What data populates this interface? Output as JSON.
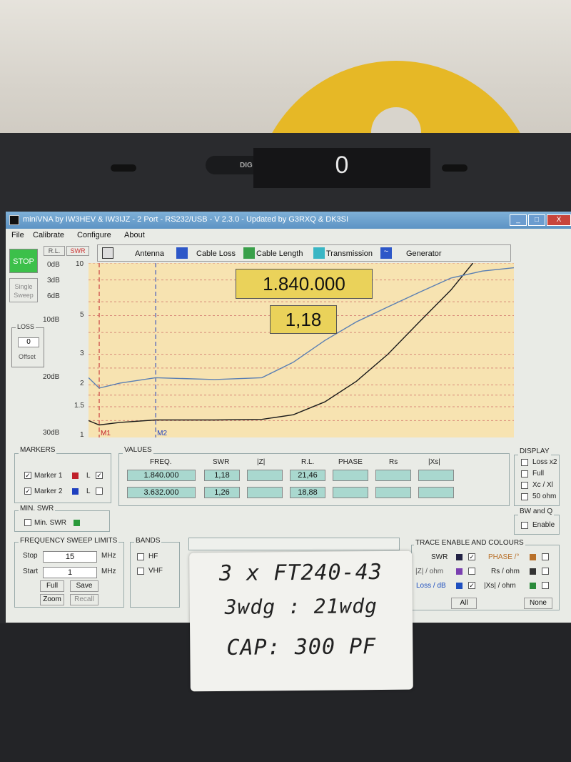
{
  "environment": {
    "digital_display": {
      "label": "DIG",
      "value": "0"
    }
  },
  "window": {
    "title": "miniVNA by IW3HEV & IW3IJZ - 2 Port - RS232/USB - V 2.3.0 - Updated by G3RXQ & DK3SI",
    "controls": {
      "minimize": "_",
      "maximize": "□",
      "close": "X"
    }
  },
  "menu": {
    "items": [
      "File",
      "Calibrate",
      "Configure",
      "About"
    ]
  },
  "left_panel": {
    "stop": "STOP",
    "single_sweep_line1": "Single",
    "single_sweep_line2": "Sweep",
    "rl_tab": "R.L.",
    "swr_tab": "SWR",
    "loss_title": "LOSS",
    "loss_value": "0",
    "offset": "Offset",
    "rl_scale": [
      "0dB",
      "3dB",
      "6dB",
      "10dB",
      "20dB",
      "30dB"
    ],
    "swr_scale": [
      "10",
      "5",
      "3",
      "2",
      "1.5",
      "1"
    ]
  },
  "modes": {
    "antenna": "Antenna",
    "cable_loss": "Cable Loss",
    "cable_length": "Cable Length",
    "transmission": "Transmission",
    "generator": "Generator"
  },
  "chart": {
    "frequency_readout": "1.840.000",
    "swr_readout": "1,18",
    "marker1_label": "M1",
    "marker2_label": "M2"
  },
  "chart_data": {
    "type": "line",
    "x_range": [
      1.5,
      15.0
    ],
    "y_axis": "swr",
    "ylim": [
      1,
      10
    ],
    "series": [
      {
        "label_key": "swr",
        "color": "#1b1b1b",
        "points": [
          [
            1.5,
            1.25
          ],
          [
            1.84,
            1.18
          ],
          [
            2.5,
            1.22
          ],
          [
            3.63,
            1.26
          ],
          [
            5.5,
            1.26
          ],
          [
            7.0,
            1.27
          ],
          [
            8.0,
            1.35
          ],
          [
            9.0,
            1.6
          ],
          [
            10.0,
            2.1
          ],
          [
            11.0,
            3.0
          ],
          [
            12.0,
            4.6
          ],
          [
            13.0,
            7.0
          ],
          [
            13.7,
            10.0
          ]
        ]
      },
      {
        "label_key": "return_loss",
        "color": "#5a7fb3",
        "points": [
          [
            1.5,
            2.2
          ],
          [
            1.84,
            1.92
          ],
          [
            2.5,
            2.05
          ],
          [
            3.63,
            2.2
          ],
          [
            5.5,
            2.15
          ],
          [
            7.0,
            2.2
          ],
          [
            8.0,
            2.7
          ],
          [
            9.0,
            3.6
          ],
          [
            10.0,
            4.6
          ],
          [
            11.0,
            5.6
          ],
          [
            12.0,
            6.8
          ],
          [
            13.0,
            8.2
          ],
          [
            14.0,
            9.0
          ],
          [
            15.0,
            9.4
          ]
        ]
      }
    ],
    "markers": [
      {
        "freq": 1.84
      },
      {
        "freq": 3.632
      }
    ]
  },
  "markers": {
    "title": "MARKERS",
    "m1": "Marker 1",
    "m2": "Marker 2",
    "l": "L"
  },
  "values": {
    "title": "VALUES",
    "headers": [
      "FREQ.",
      "SWR",
      "|Z|",
      "R.L.",
      "PHASE",
      "Rs",
      "|Xs|"
    ],
    "rows": [
      [
        "1.840.000",
        "1,18",
        "",
        "21,46",
        "",
        "",
        ""
      ],
      [
        "3.632.000",
        "1,26",
        "",
        "18,88",
        "",
        "",
        ""
      ]
    ]
  },
  "display": {
    "title": "DISPLAY",
    "loss_x2": "Loss x2",
    "full": "Full",
    "xc_xl": "Xc / Xl",
    "ohm50": "50 ohm"
  },
  "bw_q": {
    "title": "BW and Q",
    "enable": "Enable"
  },
  "min_swr": {
    "title": "MIN. SWR",
    "label": "Min. SWR"
  },
  "sweep": {
    "title": "FREQUENCY SWEEP LIMITS",
    "stop_label": "Stop",
    "stop_value": "15",
    "start_label": "Start",
    "start_value": "1",
    "unit": "MHz",
    "full": "Full",
    "save": "Save",
    "zoom": "Zoom",
    "recall": "Recall"
  },
  "bands": {
    "title": "BANDS",
    "hf": "HF",
    "vhf": "VHF"
  },
  "trace": {
    "title": "TRACE ENABLE AND COLOURS",
    "swr": "SWR",
    "z": "|Z| / ohm",
    "loss": "Loss / dB",
    "phase": "PHASE /°",
    "rs": "Rs / ohm",
    "xs": "|Xs| / ohm",
    "all": "All",
    "none": "None"
  },
  "note": {
    "line1": "3 x FT240-43",
    "line2": "3wdg : 21wdg",
    "line3": "CAP: 300 PF"
  },
  "colors": {
    "marker_red": "#c0202a",
    "marker_blue": "#1e3fbf",
    "swr_color": "#222244",
    "z_color": "#7a3fb0",
    "loss_color": "#1e4fbf",
    "phase_color": "#b8702a",
    "rs_color": "#333",
    "xs_color": "#2a8a3a",
    "min_swr_color": "#2a9a3a"
  }
}
